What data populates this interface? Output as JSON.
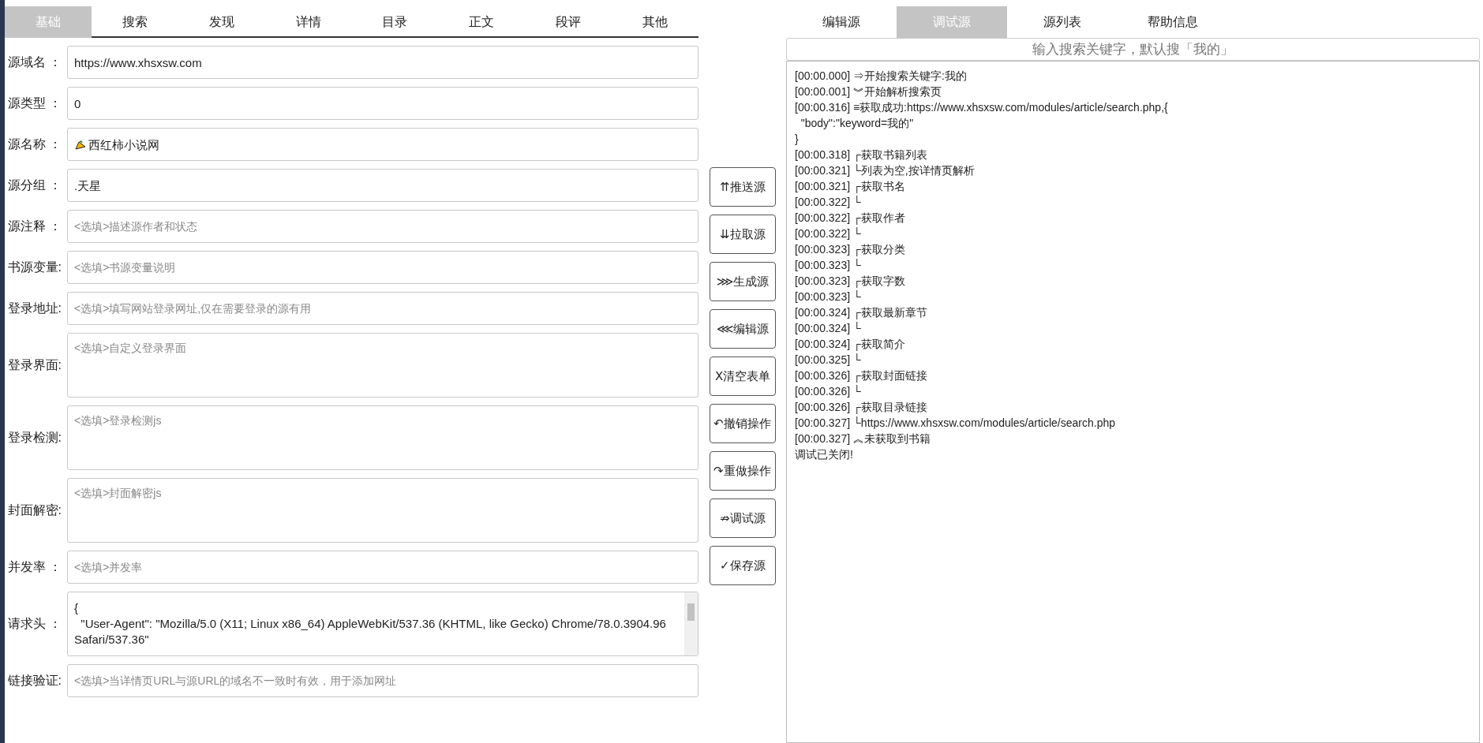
{
  "left_tabs": [
    {
      "label": "基础",
      "selected": true
    },
    {
      "label": "搜索",
      "selected": false
    },
    {
      "label": "发现",
      "selected": false
    },
    {
      "label": "详情",
      "selected": false
    },
    {
      "label": "目录",
      "selected": false
    },
    {
      "label": "正文",
      "selected": false
    },
    {
      "label": "段评",
      "selected": false
    },
    {
      "label": "其他",
      "selected": false
    }
  ],
  "fields": [
    {
      "label": "源域名 ：",
      "kind": "line",
      "value": "https://www.xhsxsw.com"
    },
    {
      "label": "源类型 ：",
      "kind": "line",
      "value": "0"
    },
    {
      "label": "源名称 ：",
      "kind": "line",
      "value": "西红柿小说网",
      "icon": true
    },
    {
      "label": "源分组 ：",
      "kind": "line",
      "value": ".天星"
    },
    {
      "label": "源注释 ：",
      "kind": "line",
      "placeholder": "<选填>描述源作者和状态"
    },
    {
      "label": "书源变量:",
      "kind": "line",
      "placeholder": "<选填>书源变量说明"
    },
    {
      "label": "登录地址:",
      "kind": "line",
      "placeholder": "<选填>填写网站登录网址,仅在需要登录的源有用"
    },
    {
      "label": "登录界面:",
      "kind": "area",
      "placeholder": "<选填>自定义登录界面"
    },
    {
      "label": "登录检测:",
      "kind": "area",
      "placeholder": "<选填>登录检测js"
    },
    {
      "label": "封面解密:",
      "kind": "area",
      "placeholder": "<选填>封面解密js"
    },
    {
      "label": "并发率 ：",
      "kind": "line",
      "placeholder": "<选填>并发率"
    },
    {
      "label": "请求头 ：",
      "kind": "code",
      "lines": [
        "{",
        "  \"User-Agent\": \"Mozilla/5.0 (X11; Linux x86_64) AppleWebKit/537.36 (KHTML, like Gecko) Chrome/78.0.3904.96",
        "Safari/537.36\""
      ]
    },
    {
      "label": "链接验证:",
      "kind": "line",
      "placeholder": "<选填>当详情页URL与源URL的域名不一致时有效，用于添加网址"
    }
  ],
  "buttons": [
    "⇈推送源",
    "⇊拉取源",
    "⋙生成源",
    "⋘编辑源",
    "Ⅹ清空表单",
    "↶撤销操作",
    "↷重做操作",
    "⇏调试源",
    "✓保存源"
  ],
  "right_tabs": [
    {
      "label": "编辑源",
      "selected": false
    },
    {
      "label": "调试源",
      "selected": true
    },
    {
      "label": "源列表",
      "selected": false
    },
    {
      "label": "帮助信息",
      "selected": false
    }
  ],
  "search": {
    "placeholder": "输入搜索关键字，默认搜「我的」"
  },
  "log": [
    "[00:00.000] ⇒开始搜索关键字:我的",
    "[00:00.001] ︾开始解析搜索页",
    "[00:00.316] ≡获取成功:https://www.xhsxsw.com/modules/article/search.php,{",
    "  \"body\":\"keyword=我的\"",
    "}",
    "[00:00.318] ┌获取书籍列表",
    "[00:00.321] └列表为空,按详情页解析",
    "[00:00.321] ┌获取书名",
    "[00:00.322] └",
    "[00:00.322] ┌获取作者",
    "[00:00.322] └",
    "[00:00.323] ┌获取分类",
    "[00:00.323] └",
    "[00:00.323] ┌获取字数",
    "[00:00.323] └",
    "[00:00.324] ┌获取最新章节",
    "[00:00.324] └",
    "[00:00.324] ┌获取简介",
    "[00:00.325] └",
    "[00:00.326] ┌获取封面链接",
    "[00:00.326] └",
    "[00:00.326] ┌获取目录链接",
    "[00:00.327] └https://www.xhsxsw.com/modules/article/search.php",
    "[00:00.327] ︽未获取到书籍",
    "调试已关闭!"
  ]
}
